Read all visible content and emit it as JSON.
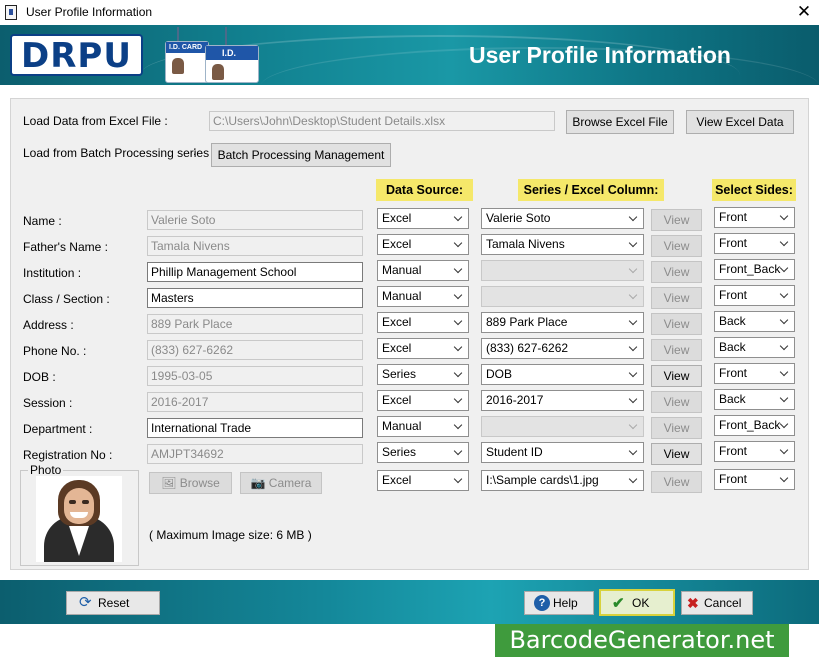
{
  "window": {
    "title": "User Profile Information"
  },
  "banner": {
    "logo": "DRPU",
    "title": "User Profile Information",
    "card_label": "I.D. CARD"
  },
  "excel": {
    "label": "Load Data from Excel File :",
    "path": "C:\\Users\\John\\Desktop\\Student Details.xlsx",
    "browse_label": "Browse Excel File",
    "view_label": "View Excel Data"
  },
  "batch": {
    "label": "Load from Batch Processing series",
    "button_label": "Batch Processing Management"
  },
  "headers": {
    "data_source": "Data Source:",
    "series_column": "Series / Excel Column:",
    "select_sides": "Select Sides:"
  },
  "fields": [
    {
      "label": "Name :",
      "value": "Valerie Soto",
      "enabled": false,
      "source": "Excel",
      "column": "Valerie Soto",
      "column_enabled": true,
      "view_enabled": false,
      "side": "Front"
    },
    {
      "label": "Father's Name :",
      "value": "Tamala Nivens",
      "enabled": false,
      "source": "Excel",
      "column": "Tamala Nivens",
      "column_enabled": true,
      "view_enabled": false,
      "side": "Front"
    },
    {
      "label": "Institution :",
      "value": "Phillip Management School",
      "enabled": true,
      "source": "Manual",
      "column": "",
      "column_enabled": false,
      "view_enabled": false,
      "side": "Front_Back"
    },
    {
      "label": "Class / Section :",
      "value": "Masters",
      "enabled": true,
      "source": "Manual",
      "column": "",
      "column_enabled": false,
      "view_enabled": false,
      "side": "Front"
    },
    {
      "label": "Address :",
      "value": "889 Park Place",
      "enabled": false,
      "source": "Excel",
      "column": "889 Park Place",
      "column_enabled": true,
      "view_enabled": false,
      "side": "Back"
    },
    {
      "label": "Phone No. :",
      "value": "(833) 627-6262",
      "enabled": false,
      "source": "Excel",
      "column": "(833) 627-6262",
      "column_enabled": true,
      "view_enabled": false,
      "side": "Back"
    },
    {
      "label": "DOB :",
      "value": "1995-03-05",
      "enabled": false,
      "source": "Series",
      "column": "DOB",
      "column_enabled": true,
      "view_enabled": true,
      "side": "Front"
    },
    {
      "label": "Session :",
      "value": "2016-2017",
      "enabled": false,
      "source": "Excel",
      "column": "2016-2017",
      "column_enabled": true,
      "view_enabled": false,
      "side": "Back"
    },
    {
      "label": "Department :",
      "value": "International Trade",
      "enabled": true,
      "source": "Manual",
      "column": "",
      "column_enabled": false,
      "view_enabled": false,
      "side": "Front_Back"
    },
    {
      "label": "Registration No :",
      "value": "AMJPT34692",
      "enabled": false,
      "source": "Series",
      "column": "Student ID",
      "column_enabled": true,
      "view_enabled": true,
      "side": "Front"
    }
  ],
  "photo": {
    "label": "Photo",
    "browse_label": "Browse",
    "camera_label": "Camera",
    "max_size_note": "( Maximum Image size: 6 MB )",
    "source": "Excel",
    "column": "I:\\Sample cards\\1.jpg",
    "side": "Front"
  },
  "view_label": "View",
  "footer": {
    "reset_label": "Reset",
    "help_label": "Help",
    "ok_label": "OK",
    "cancel_label": "Cancel",
    "watermark": "BarcodeGenerator.net"
  },
  "colors": {
    "banner": "#11808f",
    "header_yellow": "#f5e86a",
    "watermark_green": "#3f9b3d",
    "logo_blue": "#0b3f86"
  }
}
